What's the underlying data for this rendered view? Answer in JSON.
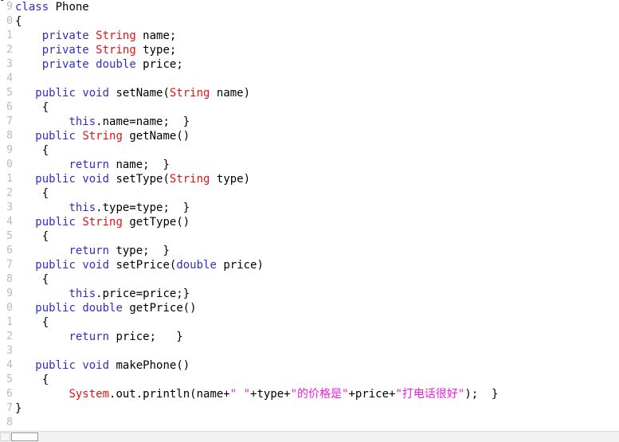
{
  "editor": {
    "language": "java",
    "colors": {
      "background": "#ffffff",
      "gutter_text": "#b9b9b9",
      "keyword": "#2f2fc4",
      "type": "#e81010",
      "string": "#ee1ee0",
      "plain": "#000000",
      "scrollbar_track": "#f1f1f1",
      "scrollbar_thumb": "#fdfdfd"
    },
    "clipped_top_line": "}",
    "lines": [
      {
        "number": "9",
        "tokens": [
          {
            "t": "class",
            "c": "kw"
          },
          {
            "t": " Phone",
            "c": "plain"
          }
        ]
      },
      {
        "number": "0",
        "tokens": [
          {
            "t": "{",
            "c": "plain"
          }
        ]
      },
      {
        "number": "1",
        "tokens": [
          {
            "t": "    ",
            "c": "plain"
          },
          {
            "t": "private",
            "c": "kw"
          },
          {
            "t": " ",
            "c": "plain"
          },
          {
            "t": "String",
            "c": "type"
          },
          {
            "t": " name;",
            "c": "plain"
          }
        ]
      },
      {
        "number": "2",
        "tokens": [
          {
            "t": "    ",
            "c": "plain"
          },
          {
            "t": "private",
            "c": "kw"
          },
          {
            "t": " ",
            "c": "plain"
          },
          {
            "t": "String",
            "c": "type"
          },
          {
            "t": " type;",
            "c": "plain"
          }
        ]
      },
      {
        "number": "3",
        "tokens": [
          {
            "t": "    ",
            "c": "plain"
          },
          {
            "t": "private",
            "c": "kw"
          },
          {
            "t": " ",
            "c": "plain"
          },
          {
            "t": "double",
            "c": "kw"
          },
          {
            "t": " price;",
            "c": "plain"
          }
        ]
      },
      {
        "number": "4",
        "tokens": []
      },
      {
        "number": "5",
        "tokens": [
          {
            "t": "   ",
            "c": "plain"
          },
          {
            "t": "public",
            "c": "kw"
          },
          {
            "t": " ",
            "c": "plain"
          },
          {
            "t": "void",
            "c": "kw"
          },
          {
            "t": " setName(",
            "c": "plain"
          },
          {
            "t": "String",
            "c": "type"
          },
          {
            "t": " name)",
            "c": "plain"
          }
        ]
      },
      {
        "number": "6",
        "tokens": [
          {
            "t": "    {",
            "c": "plain"
          }
        ]
      },
      {
        "number": "7",
        "tokens": [
          {
            "t": "        ",
            "c": "plain"
          },
          {
            "t": "this",
            "c": "kw"
          },
          {
            "t": ".name=name;  }",
            "c": "plain"
          }
        ]
      },
      {
        "number": "8",
        "tokens": [
          {
            "t": "   ",
            "c": "plain"
          },
          {
            "t": "public",
            "c": "kw"
          },
          {
            "t": " ",
            "c": "plain"
          },
          {
            "t": "String",
            "c": "type"
          },
          {
            "t": " getName()",
            "c": "plain"
          }
        ]
      },
      {
        "number": "9",
        "tokens": [
          {
            "t": "    {",
            "c": "plain"
          }
        ]
      },
      {
        "number": "0",
        "tokens": [
          {
            "t": "        ",
            "c": "plain"
          },
          {
            "t": "return",
            "c": "kw"
          },
          {
            "t": " name;  }",
            "c": "plain"
          }
        ]
      },
      {
        "number": "1",
        "tokens": [
          {
            "t": "   ",
            "c": "plain"
          },
          {
            "t": "public",
            "c": "kw"
          },
          {
            "t": " ",
            "c": "plain"
          },
          {
            "t": "void",
            "c": "kw"
          },
          {
            "t": " setType(",
            "c": "plain"
          },
          {
            "t": "String",
            "c": "type"
          },
          {
            "t": " type)",
            "c": "plain"
          }
        ]
      },
      {
        "number": "2",
        "tokens": [
          {
            "t": "    {",
            "c": "plain"
          }
        ]
      },
      {
        "number": "3",
        "tokens": [
          {
            "t": "        ",
            "c": "plain"
          },
          {
            "t": "this",
            "c": "kw"
          },
          {
            "t": ".type=type;  }",
            "c": "plain"
          }
        ]
      },
      {
        "number": "4",
        "tokens": [
          {
            "t": "   ",
            "c": "plain"
          },
          {
            "t": "public",
            "c": "kw"
          },
          {
            "t": " ",
            "c": "plain"
          },
          {
            "t": "String",
            "c": "type"
          },
          {
            "t": " getType()",
            "c": "plain"
          }
        ]
      },
      {
        "number": "5",
        "tokens": [
          {
            "t": "    {",
            "c": "plain"
          }
        ]
      },
      {
        "number": "6",
        "tokens": [
          {
            "t": "        ",
            "c": "plain"
          },
          {
            "t": "return",
            "c": "kw"
          },
          {
            "t": " type;  }",
            "c": "plain"
          }
        ]
      },
      {
        "number": "7",
        "tokens": [
          {
            "t": "   ",
            "c": "plain"
          },
          {
            "t": "public",
            "c": "kw"
          },
          {
            "t": " ",
            "c": "plain"
          },
          {
            "t": "void",
            "c": "kw"
          },
          {
            "t": " setPrice(",
            "c": "plain"
          },
          {
            "t": "double",
            "c": "kw"
          },
          {
            "t": " price)",
            "c": "plain"
          }
        ]
      },
      {
        "number": "8",
        "tokens": [
          {
            "t": "    {",
            "c": "plain"
          }
        ]
      },
      {
        "number": "9",
        "tokens": [
          {
            "t": "        ",
            "c": "plain"
          },
          {
            "t": "this",
            "c": "kw"
          },
          {
            "t": ".price=price;}",
            "c": "plain"
          }
        ]
      },
      {
        "number": "0",
        "tokens": [
          {
            "t": "   ",
            "c": "plain"
          },
          {
            "t": "public",
            "c": "kw"
          },
          {
            "t": " ",
            "c": "plain"
          },
          {
            "t": "double",
            "c": "kw"
          },
          {
            "t": " getPrice()",
            "c": "plain"
          }
        ]
      },
      {
        "number": "1",
        "tokens": [
          {
            "t": "    {",
            "c": "plain"
          }
        ]
      },
      {
        "number": "2",
        "tokens": [
          {
            "t": "        ",
            "c": "plain"
          },
          {
            "t": "return",
            "c": "kw"
          },
          {
            "t": " price;   }",
            "c": "plain"
          }
        ]
      },
      {
        "number": "3",
        "tokens": []
      },
      {
        "number": "4",
        "tokens": [
          {
            "t": "   ",
            "c": "plain"
          },
          {
            "t": "public",
            "c": "kw"
          },
          {
            "t": " ",
            "c": "plain"
          },
          {
            "t": "void",
            "c": "kw"
          },
          {
            "t": " makePhone()",
            "c": "plain"
          }
        ]
      },
      {
        "number": "5",
        "tokens": [
          {
            "t": "    {",
            "c": "plain"
          }
        ]
      },
      {
        "number": "6",
        "tokens": [
          {
            "t": "        ",
            "c": "plain"
          },
          {
            "t": "System",
            "c": "type"
          },
          {
            "t": ".out.println(name+",
            "c": "plain"
          },
          {
            "t": "\" \"",
            "c": "str"
          },
          {
            "t": "+type+",
            "c": "plain"
          },
          {
            "t": "\"的价格是\"",
            "c": "str"
          },
          {
            "t": "+price+",
            "c": "plain"
          },
          {
            "t": "\"打电话很好\"",
            "c": "str"
          },
          {
            "t": ");  }",
            "c": "plain"
          }
        ]
      },
      {
        "number": "7",
        "tokens": [
          {
            "t": "}",
            "c": "plain"
          }
        ]
      },
      {
        "number": "8",
        "tokens": []
      }
    ]
  },
  "scrollbar": {
    "orientation": "horizontal",
    "thumb_position_percent": 2
  }
}
